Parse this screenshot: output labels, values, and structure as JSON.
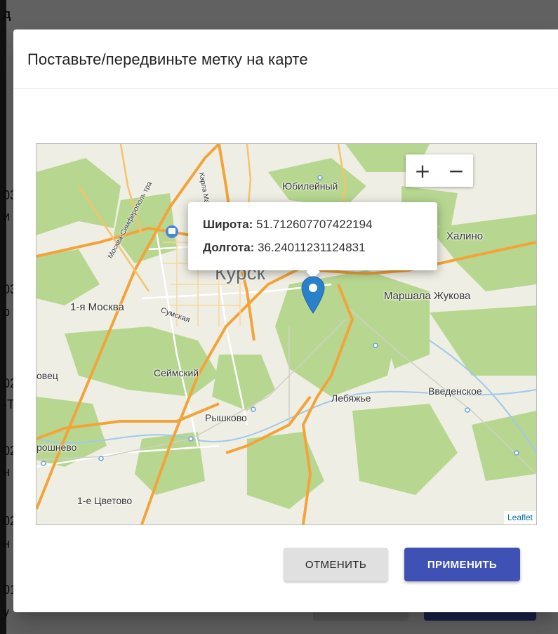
{
  "background": {
    "fragments": [
      "д",
      "03",
      "и",
      "03",
      "р",
      "02",
      "-Т",
      "02",
      "н",
      "02",
      "н",
      "01",
      "у"
    ]
  },
  "dialog": {
    "title": "Поставьте/передвиньте метку на карте",
    "cancel_label": "ОТМЕНИТЬ",
    "apply_label": "ПРИМЕНИТЬ"
  },
  "map": {
    "zoom_in": "+",
    "zoom_out": "−",
    "attribution": "Leaflet",
    "popup": {
      "lat_label": "Широта:",
      "lat_value": "51.712607707422194",
      "lon_label": "Долгота:",
      "lon_value": "36.24011231124831"
    },
    "places": {
      "kursk": "Курск",
      "yubileyny": "Юбилейный",
      "khalino": "Халино",
      "marshala": "Маршала Жукова",
      "moskva1": "1-я Москва",
      "sumskaya": "Сумская",
      "seymsky": "Сеймский",
      "lebyazhye": "Лебяжье",
      "vvedenskoe": "Введенское",
      "ryshkovo": "Рышково",
      "roshnevo": "рошнево",
      "tsvetovo": "1-е Цветово",
      "ovets": "овец",
      "karla_marksa": "Карла Маркс",
      "simferopol": "Москва-Симферополь тра"
    }
  },
  "colors": {
    "primary": "#3f51b5",
    "marker": "#2a81cb",
    "road": "#f2a43a",
    "forest": "#b5d68e"
  }
}
